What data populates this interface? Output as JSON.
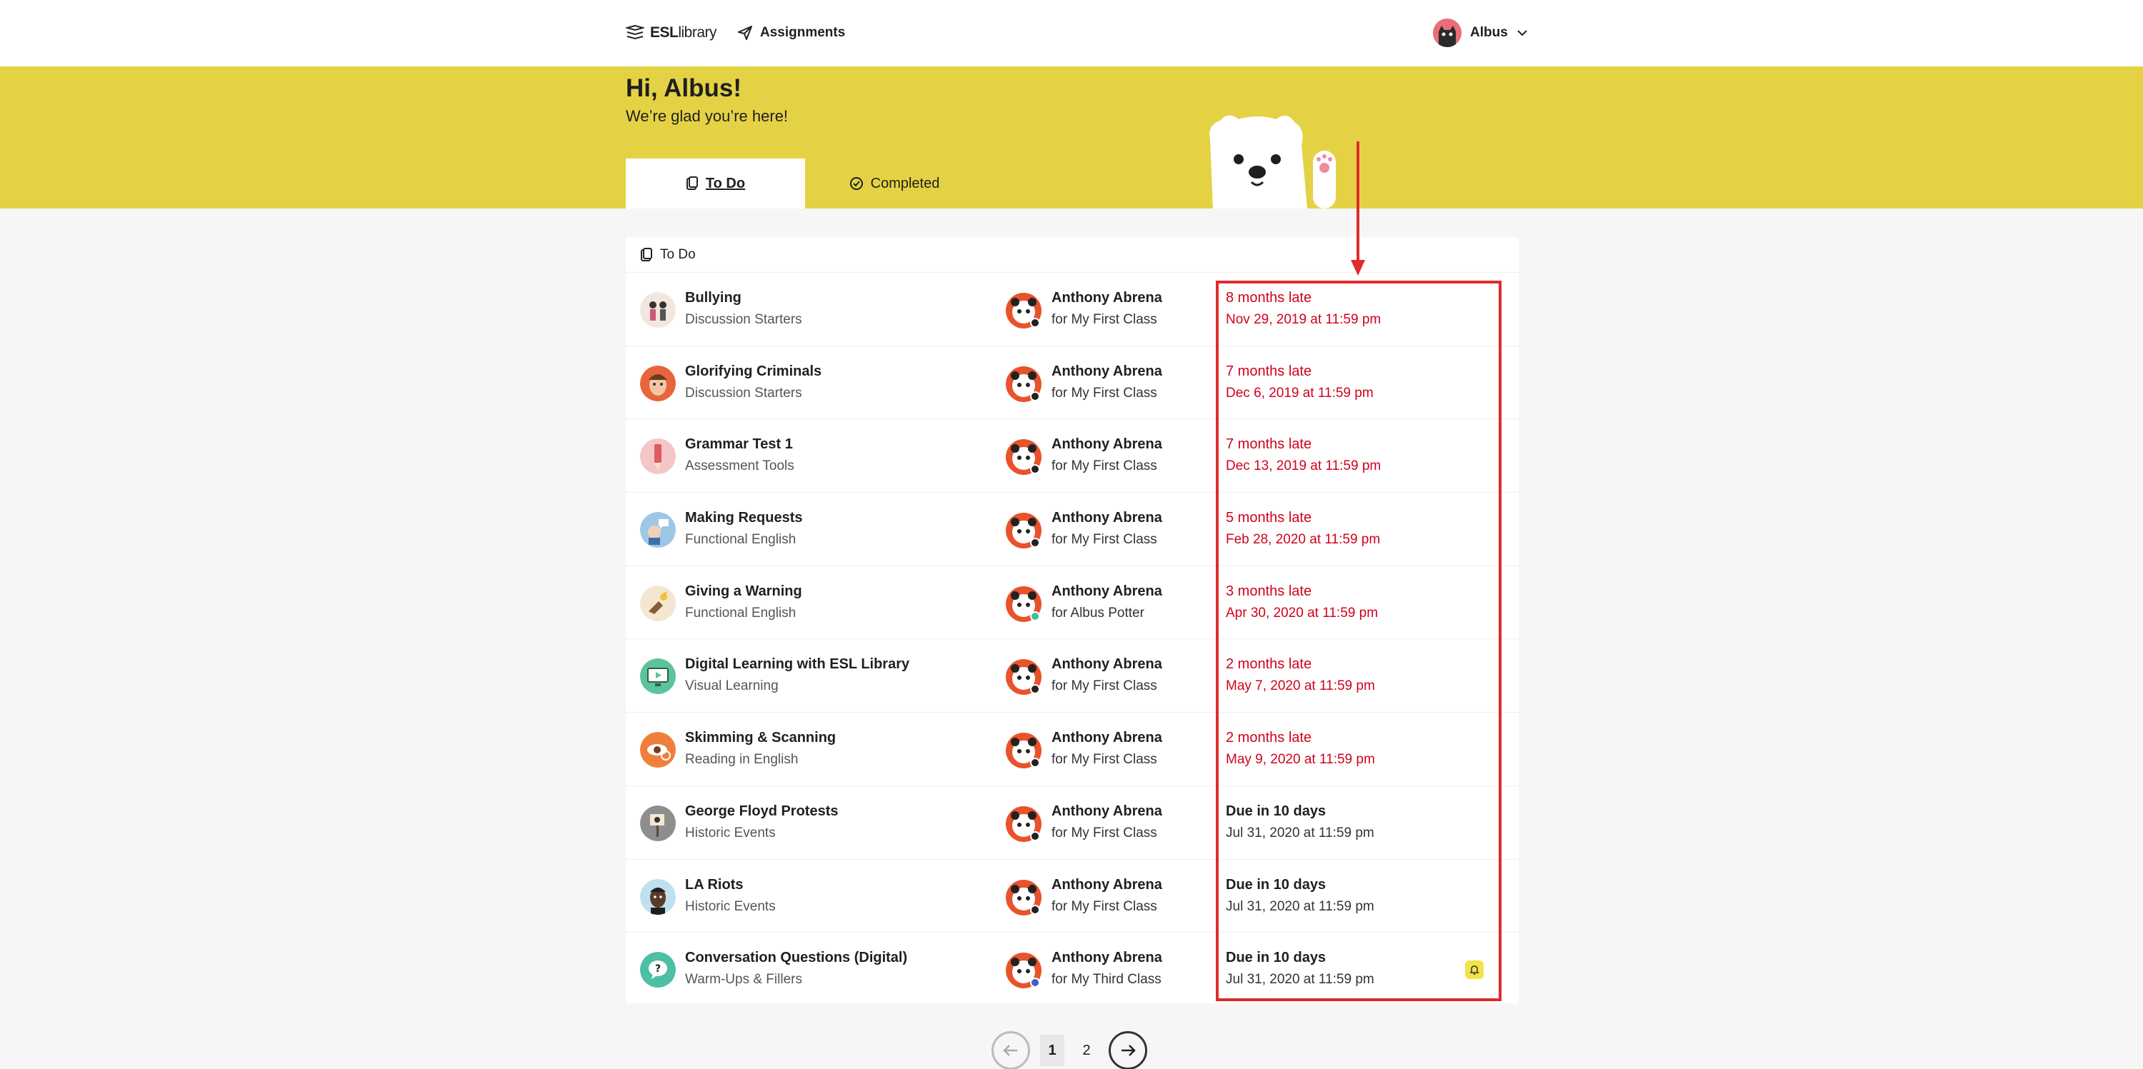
{
  "header": {
    "brand_bold": "ESL",
    "brand_light": "library",
    "nav_assignments": "Assignments",
    "user_name": "Albus"
  },
  "hero": {
    "greeting": "Hi, Albus!",
    "subgreeting": "We’re glad you’re here!"
  },
  "tabs": [
    {
      "label": "To Do",
      "active": true
    },
    {
      "label": "Completed",
      "active": false
    }
  ],
  "list": {
    "heading": "To Do",
    "rows": [
      {
        "title": "Bullying",
        "category": "Discussion Starters",
        "teacher": "Anthony Abrena",
        "class": "for My First Class",
        "status": "8 months late",
        "due": "Nov 29, 2019 at 11:59 pm",
        "state": "late"
      },
      {
        "title": "Glorifying Criminals",
        "category": "Discussion Starters",
        "teacher": "Anthony Abrena",
        "class": "for My First Class",
        "status": "7 months late",
        "due": "Dec 6, 2019 at 11:59 pm",
        "state": "late"
      },
      {
        "title": "Grammar Test 1",
        "category": "Assessment Tools",
        "teacher": "Anthony Abrena",
        "class": "for My First Class",
        "status": "7 months late",
        "due": "Dec 13, 2019 at 11:59 pm",
        "state": "late"
      },
      {
        "title": "Making Requests",
        "category": "Functional English",
        "teacher": "Anthony Abrena",
        "class": "for My First Class",
        "status": "5 months late",
        "due": "Feb 28, 2020 at 11:59 pm",
        "state": "late"
      },
      {
        "title": "Giving a Warning",
        "category": "Functional English",
        "teacher": "Anthony Abrena",
        "class": "for Albus Potter",
        "status": "3 months late",
        "due": "Apr 30, 2020 at 11:59 pm",
        "state": "late"
      },
      {
        "title": "Digital Learning with ESL Library",
        "category": "Visual Learning",
        "teacher": "Anthony Abrena",
        "class": "for My First Class",
        "status": "2 months late",
        "due": "May 7, 2020 at 11:59 pm",
        "state": "late"
      },
      {
        "title": "Skimming & Scanning",
        "category": "Reading in English",
        "teacher": "Anthony Abrena",
        "class": "for My First Class",
        "status": "2 months late",
        "due": "May 9, 2020 at 11:59 pm",
        "state": "late"
      },
      {
        "title": "George Floyd Protests",
        "category": "Historic Events",
        "teacher": "Anthony Abrena",
        "class": "for My First Class",
        "status": "Due in 10 days",
        "due": "Jul 31, 2020 at 11:59 pm",
        "state": "due"
      },
      {
        "title": "LA Riots",
        "category": "Historic Events",
        "teacher": "Anthony Abrena",
        "class": "for My First Class",
        "status": "Due in 10 days",
        "due": "Jul 31, 2020 at 11:59 pm",
        "state": "due"
      },
      {
        "title": "Conversation Questions (Digital)",
        "category": "Warm-Ups & Fillers",
        "teacher": "Anthony Abrena",
        "class": "for My Third Class",
        "status": "Due in 10 days",
        "due": "Jul 31, 2020 at 11:59 pm",
        "state": "due"
      }
    ]
  },
  "pagination": {
    "pages": [
      "1",
      "2"
    ],
    "current": "1"
  },
  "colors": {
    "hero": "#e5d244",
    "late": "#d0021b",
    "annotation": "#e02b2b",
    "bell": "#f3e34a"
  }
}
